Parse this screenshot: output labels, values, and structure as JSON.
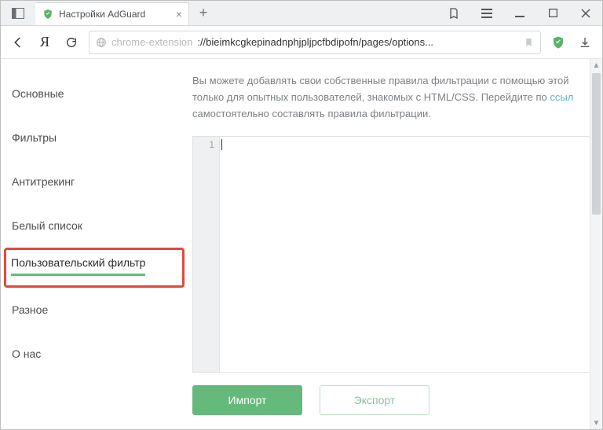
{
  "titlebar": {
    "tab_title": "Настройки AdGuard"
  },
  "address": {
    "prefix": "chrome-extension",
    "path": "://bieimkcgkepinadnphjpljpcfbdipofn/pages/options..."
  },
  "sidebar": {
    "items": [
      "Основные",
      "Фильтры",
      "Антитрекинг",
      "Белый список",
      "Пользовательский фильтр",
      "Разное",
      "О нас"
    ],
    "active_index": 4
  },
  "main": {
    "description_part1": "Вы можете добавлять свои собственные правила фильтрации с помощью этой только для опытных пользователей, знакомых с HTML/CSS. Перейдите по ",
    "description_link": "ссыл",
    "description_part2": " самостоятельно составлять правила фильтрации.",
    "line_number": "1",
    "import_label": "Импорт",
    "export_label": "Экспорт"
  }
}
